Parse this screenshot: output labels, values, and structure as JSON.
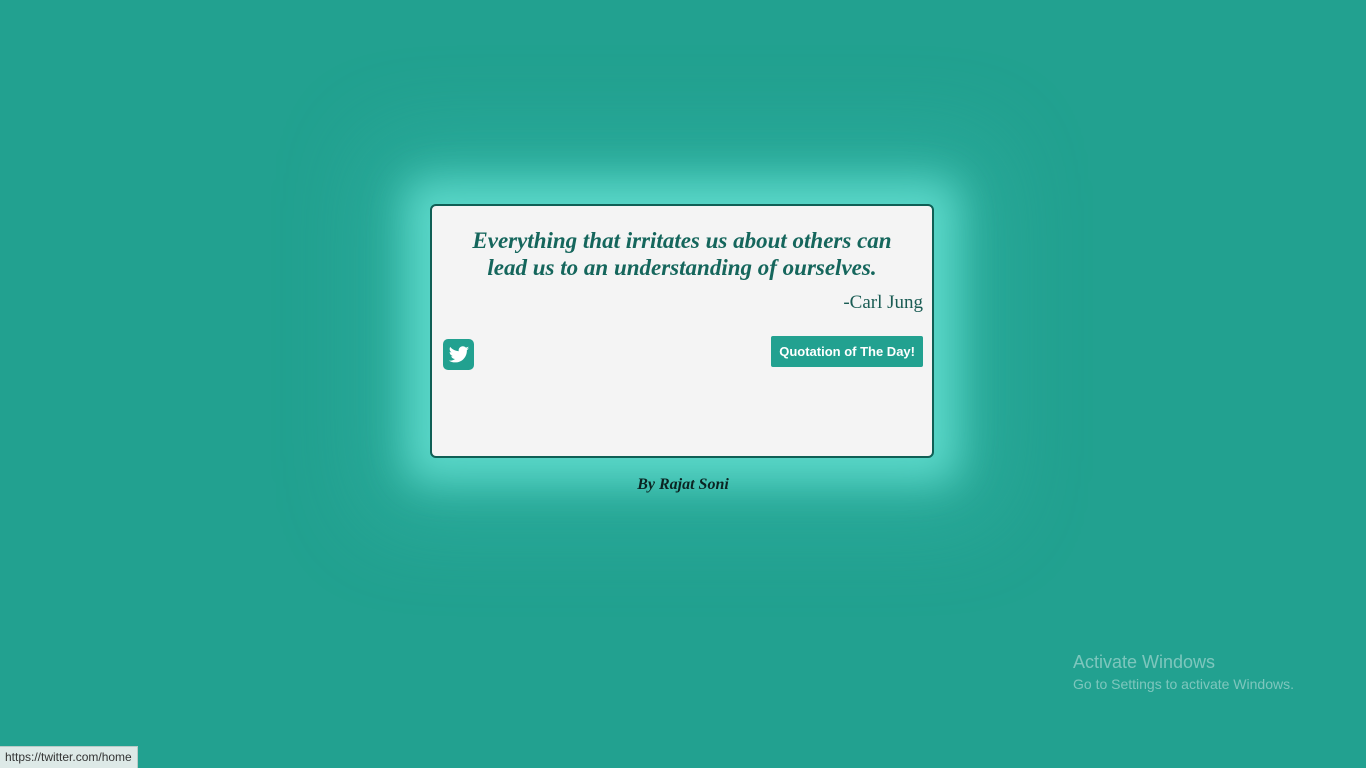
{
  "quote": {
    "text": "Everything that irritates us about others can lead us to an understanding of ourselves.",
    "author": "-Carl Jung"
  },
  "actions": {
    "tweet_icon": "twitter-bird-icon",
    "new_quote_label": "Quotation of The Day!"
  },
  "footer": {
    "byline": "By Rajat Soni"
  },
  "watermark": {
    "title": "Activate Windows",
    "subtitle": "Go to Settings to activate Windows."
  },
  "status_bar": {
    "url": "https://twitter.com/home"
  },
  "colors": {
    "background": "#22a190",
    "card": "#f4f4f4",
    "quote_text": "#15665c",
    "button": "#22a190"
  }
}
